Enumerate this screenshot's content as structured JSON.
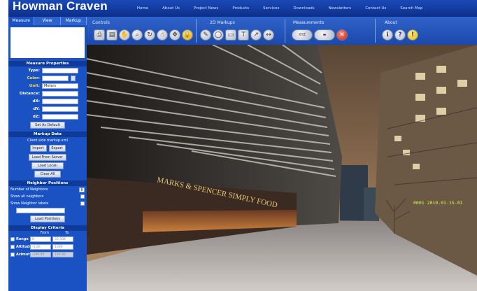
{
  "app": {
    "title": "Howman Craven"
  },
  "topnav": [
    "Home",
    "About Us",
    "Project News",
    "Products",
    "Services",
    "Downloads",
    "Newsletters",
    "Contact Us",
    "Search Map"
  ],
  "sidebar": {
    "tabs": [
      "Measure",
      "View",
      "Markup"
    ],
    "measure_properties": {
      "title": "Measure Properties",
      "type_label": "Type:",
      "color_label": "Color:",
      "unit_label": "Unit:",
      "unit_value": "Meters",
      "distance_label": "Distance:",
      "dx_label": "dX:",
      "dy_label": "dY:",
      "dz_label": "dZ:",
      "set_default": "Set As Default"
    },
    "markup_data": {
      "title": "Markup Data",
      "client_file": "Client side markup.xml",
      "import": "Import",
      "export": "Export",
      "load_server": "Load From Server",
      "load_local": "Load Locali",
      "clear_all": "Clear All"
    },
    "neighbors": {
      "title": "Neighbor Positions",
      "number_label": "Number of Neighbors",
      "number_value": "8",
      "show_all": "Show all neighbors",
      "show_labels": "Show Neighbor labels",
      "load_positions": "Load Positions"
    },
    "display_criteria": {
      "title": "Display Criteria",
      "from": "From",
      "to": "To",
      "rows": [
        {
          "name": "Range",
          "from": "0",
          "to": "33.338",
          "disabled": false
        },
        {
          "name": "Altitude",
          "from": "-5.00",
          "to": "1000",
          "disabled": false
        },
        {
          "name": "Azimuth",
          "from": "-180.00",
          "to": "180.00",
          "disabled": true
        }
      ]
    }
  },
  "toolbar": {
    "controls": "Controls",
    "markups": "2D Markups",
    "measurements": "Measurements",
    "about": "About",
    "icons": {
      "controls": [
        "print-icon",
        "printer-icon",
        "hand-icon",
        "zoom-icon",
        "rotate-icon",
        "pointer-icon",
        "pan-icon",
        "lock-icon"
      ],
      "markups": [
        "pen-icon",
        "ellipse-icon",
        "rectangle-icon",
        "text-icon",
        "arrow-icon",
        "dimension-icon"
      ],
      "measurements": [
        "xyz-icon",
        "ruler-icon",
        "clear-icon"
      ],
      "about": [
        "info-icon",
        "help-icon",
        "warning-icon"
      ]
    },
    "xyz_label": "XYZ"
  },
  "viewer": {
    "storefront_sign": "MARKS & SPENCER SIMPLY FOOD",
    "overlay_id": "0001 2010.01.15-01"
  },
  "colors": {
    "brand_blue": "#1a52c4",
    "header_blue": "#0e3a9a",
    "overlay_green": "#c7ff4a"
  }
}
